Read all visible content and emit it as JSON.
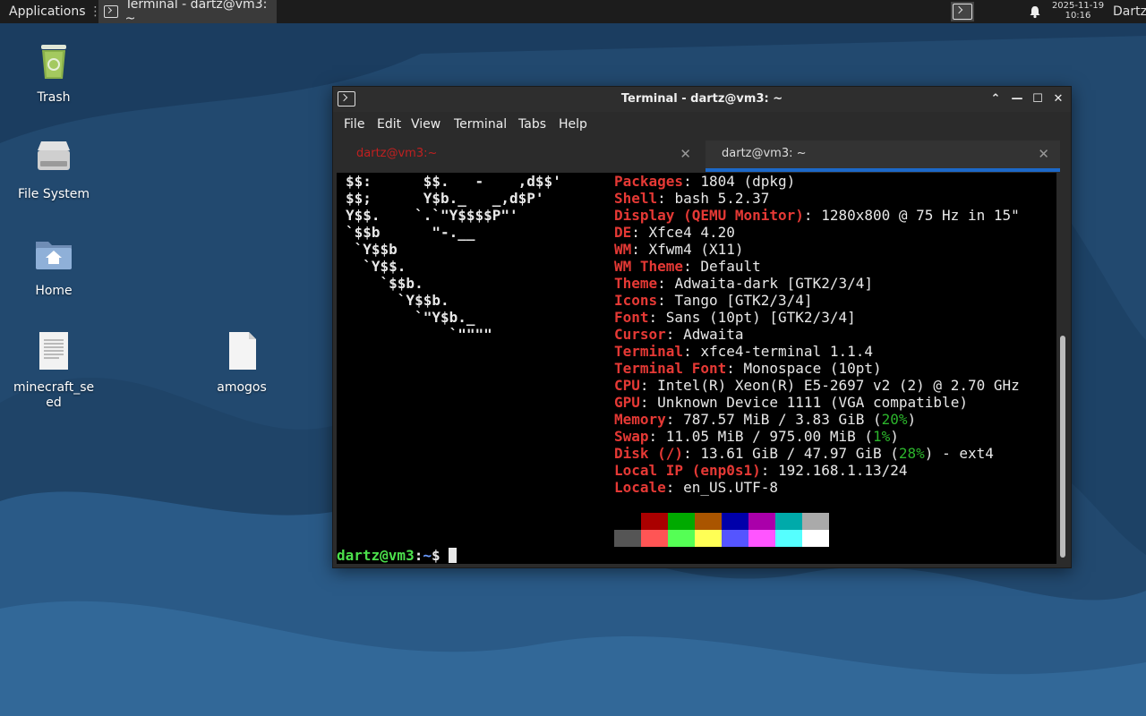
{
  "panel": {
    "apps_label": "Applications",
    "task_label": "Terminal - dartz@vm3: ~",
    "clock_date": "2025-11-19",
    "clock_time": "10:16",
    "user": "Dartz"
  },
  "desktop": {
    "icons": [
      {
        "label": "Trash"
      },
      {
        "label": "File System"
      },
      {
        "label": "Home"
      },
      {
        "label": "minecraft_se ed"
      },
      {
        "label": "amogos"
      }
    ]
  },
  "window": {
    "title": "Terminal - dartz@vm3: ~",
    "menu": [
      "File",
      "Edit",
      "View",
      "Terminal",
      "Tabs",
      "Help"
    ],
    "tabs": [
      {
        "label": "dartz@vm3:~"
      },
      {
        "label": "dartz@vm3: ~"
      }
    ]
  },
  "terminal": {
    "logo": [
      "$$:      $$.   -    ,d$$'",
      "$$;      Y$b._   _,d$P'",
      "Y$$.    `.`\"Y$$$$P\"'",
      "`$$b      \"-.__",
      " `Y$$b",
      "  `Y$$.",
      "    `$$b.",
      "      `Y$$b.",
      "        `\"Y$b._",
      "            `\"\"\"\""
    ],
    "info": [
      {
        "key": "Packages",
        "value": "1804 (dpkg)"
      },
      {
        "key": "Shell",
        "value": "bash 5.2.37"
      },
      {
        "key": "Display (QEMU Monitor)",
        "value": "1280x800 @ 75 Hz in 15\""
      },
      {
        "key": "DE",
        "value": "Xfce4 4.20"
      },
      {
        "key": "WM",
        "value": "Xfwm4 (X11)"
      },
      {
        "key": "WM Theme",
        "value": "Default"
      },
      {
        "key": "Theme",
        "value": "Adwaita-dark [GTK2/3/4]"
      },
      {
        "key": "Icons",
        "value": "Tango [GTK2/3/4]"
      },
      {
        "key": "Font",
        "value": "Sans (10pt) [GTK2/3/4]"
      },
      {
        "key": "Cursor",
        "value": "Adwaita"
      },
      {
        "key": "Terminal",
        "value": "xfce4-terminal 1.1.4"
      },
      {
        "key": "Terminal Font",
        "value": "Monospace (10pt)"
      },
      {
        "key": "CPU",
        "value": "Intel(R) Xeon(R) E5-2697 v2 (2) @ 2.70 GHz"
      },
      {
        "key": "GPU",
        "value": "Unknown Device 1111 (VGA compatible)"
      },
      {
        "key": "Memory",
        "value": "787.57 MiB / 3.83 GiB (",
        "pct": "20%",
        "tail": ")"
      },
      {
        "key": "Swap",
        "value": "11.05 MiB / 975.00 MiB (",
        "pct": "1%",
        "tail": ")"
      },
      {
        "key": "Disk (/)",
        "value": "13.61 GiB / 47.97 GiB (",
        "pct": "28%",
        "tail": ") - ext4"
      },
      {
        "key": "Local IP (enp0s1)",
        "value": "192.168.1.13/24"
      },
      {
        "key": "Locale",
        "value": "en_US.UTF-8"
      }
    ],
    "palette_top": [
      "#000000",
      "#aa0000",
      "#00aa00",
      "#aa5500",
      "#0000aa",
      "#aa00aa",
      "#00aaaa",
      "#aaaaaa"
    ],
    "palette_bottom": [
      "#555555",
      "#ff5555",
      "#55ff55",
      "#ffff55",
      "#5555ff",
      "#ff55ff",
      "#55ffff",
      "#ffffff"
    ],
    "prompt_user": "dartz@vm3",
    "prompt_sep": ":",
    "prompt_path": "~",
    "prompt_sym": "$"
  },
  "colors": {
    "desktop_bg": "#22496f",
    "accent": "#1c68c8",
    "label_red": "#e53935",
    "prompt_green": "#4ce04c"
  }
}
